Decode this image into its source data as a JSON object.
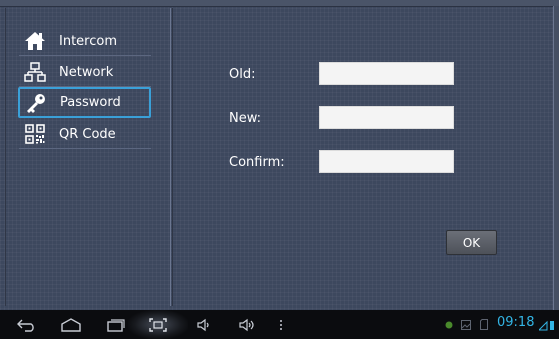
{
  "sidebar": {
    "items": [
      {
        "label": "Intercom",
        "icon": "home-icon",
        "active": false
      },
      {
        "label": "Network",
        "icon": "network-icon",
        "active": false
      },
      {
        "label": "Password",
        "icon": "key-icon",
        "active": true
      },
      {
        "label": "QR Code",
        "icon": "qr-code-icon",
        "active": false
      }
    ]
  },
  "form": {
    "old_label": "Old:",
    "new_label": "New:",
    "confirm_label": "Confirm:",
    "old_value": "",
    "new_value": "",
    "confirm_value": "",
    "ok_label": "OK"
  },
  "statusbar": {
    "time": "09:18"
  },
  "colors": {
    "background": "#3d485e",
    "accent": "#33b5e5",
    "active_border": "#3aa0d8"
  }
}
